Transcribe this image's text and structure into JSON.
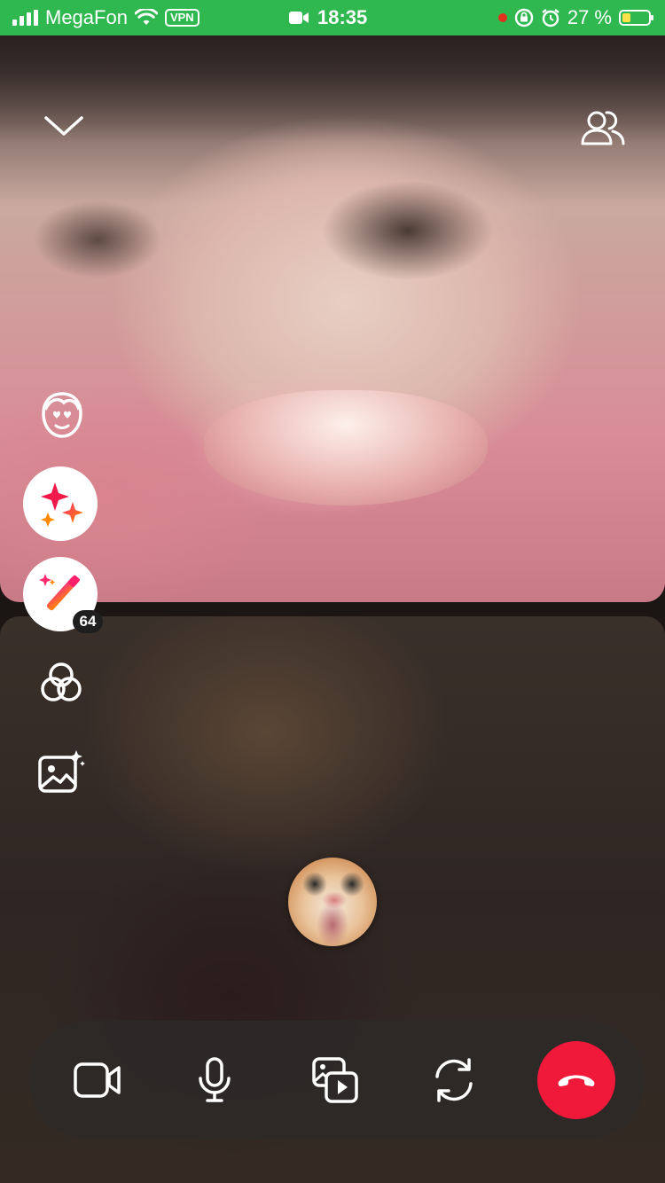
{
  "status_bar": {
    "carrier": "MegaFon",
    "vpn_label": "VPN",
    "time": "18:35",
    "battery_text": "27 %",
    "icons": [
      "signal-icon",
      "wifi-icon",
      "video-recording-icon",
      "recording-dot-icon",
      "rotation-lock-icon",
      "alarm-icon",
      "battery-charging-icon"
    ]
  },
  "call": {
    "remote_top_icons": [
      "chevron-down-icon",
      "participants-icon"
    ],
    "effects": {
      "wand_count": "64",
      "icons": [
        "face-mask-icon",
        "sparkles-icon",
        "magic-wand-icon",
        "filters-icon",
        "background-image-icon"
      ]
    },
    "controls": {
      "icons": [
        "video-camera-icon",
        "microphone-icon",
        "screen-share-icon",
        "switch-camera-icon",
        "end-call-icon"
      ],
      "end_call_color": "#f0193a"
    }
  },
  "colors": {
    "status_bar_bg": "#2fb84f",
    "controls_bg": "#2d2928",
    "badge_bg": "#1f1f1f"
  }
}
